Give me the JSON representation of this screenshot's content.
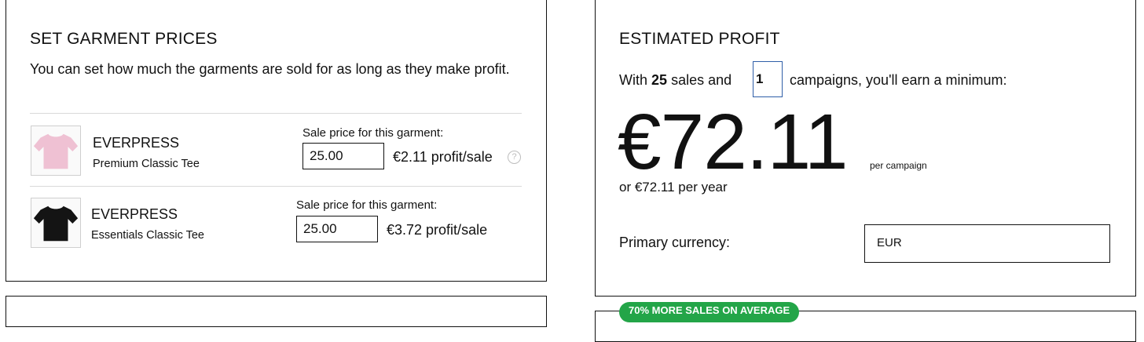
{
  "garment_prices": {
    "title": "SET GARMENT PRICES",
    "description": "You can set how much the garments are sold for as long as they make profit.",
    "items": [
      {
        "brand": "EVERPRESS",
        "model": "Premium Classic Tee",
        "sale_label": "Sale price for this garment:",
        "price": "25.00",
        "profit": "€2.11 profit/sale",
        "shirt_color": "#efc1d3"
      },
      {
        "brand": "EVERPRESS",
        "model": "Essentials Classic Tee",
        "sale_label": "Sale price for this garment:",
        "price": "25.00",
        "profit": "€3.72 profit/sale",
        "shirt_color": "#141414"
      }
    ]
  },
  "estimated_profit": {
    "title": "ESTIMATED PROFIT",
    "sentence_prefix": "With",
    "sales_count": "25",
    "sentence_middle": "sales and",
    "campaigns_value": "1",
    "sentence_suffix": "campaigns, you'll earn a minimum:",
    "amount": "€72.11",
    "per_campaign": "per campaign",
    "per_year": "or €72.11 per year",
    "currency_label": "Primary currency:",
    "currency_value": "EUR"
  },
  "badge": {
    "text": "70% MORE SALES ON AVERAGE",
    "color": "#23a548"
  },
  "colors": {
    "input_focus_border": "#2f5ea8",
    "help_icon": "#bdbdbd"
  }
}
